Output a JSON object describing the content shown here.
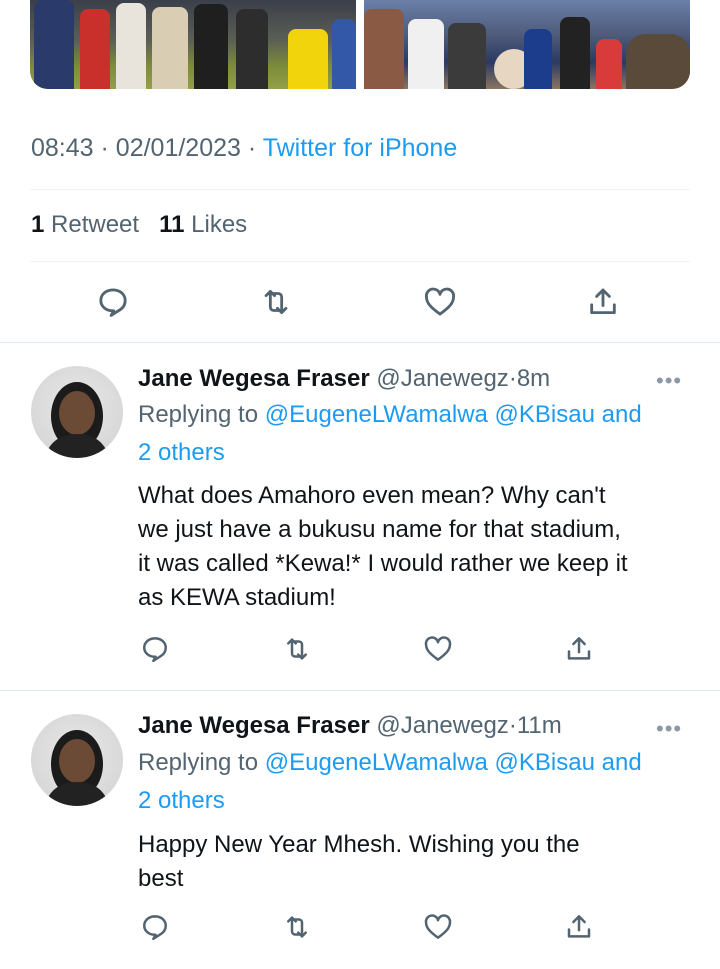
{
  "main_tweet": {
    "time": "08:43",
    "separator": "·",
    "date": "02/01/2023",
    "source": "Twitter for iPhone",
    "retweet_count": "1",
    "retweet_label": "Retweet",
    "like_count": "11",
    "like_label": "Likes"
  },
  "replies": [
    {
      "name": "Jane Wegesa Fraser",
      "handle": "@Janewegz",
      "separator": "·",
      "time": "8m",
      "replying_prefix": "Replying to",
      "replying_users": "@EugeneLWamalwa @KBisau and",
      "replying_others": "2 others",
      "text_lines": [
        "What does Amahoro even mean? Why can't",
        "we just have a bukusu name for that stadium,",
        "it was called *Kewa!* I would rather we keep it",
        "as KEWA stadium!"
      ],
      "more": "•••"
    },
    {
      "name": "Jane Wegesa Fraser",
      "handle": "@Janewegz",
      "separator": "·",
      "time": "11m",
      "replying_prefix": "Replying to",
      "replying_users": "@EugeneLWamalwa @KBisau and",
      "replying_others": "2 others",
      "text_lines": [
        "Happy New Year Mhesh. Wishing you the",
        "best"
      ],
      "more": "•••"
    }
  ],
  "icons": {
    "reply": "reply-icon",
    "retweet": "retweet-icon",
    "like": "heart-icon",
    "share": "share-icon"
  },
  "colors": {
    "link": "#1d9bf0",
    "secondary_text": "#536471",
    "icon": "#536471"
  }
}
